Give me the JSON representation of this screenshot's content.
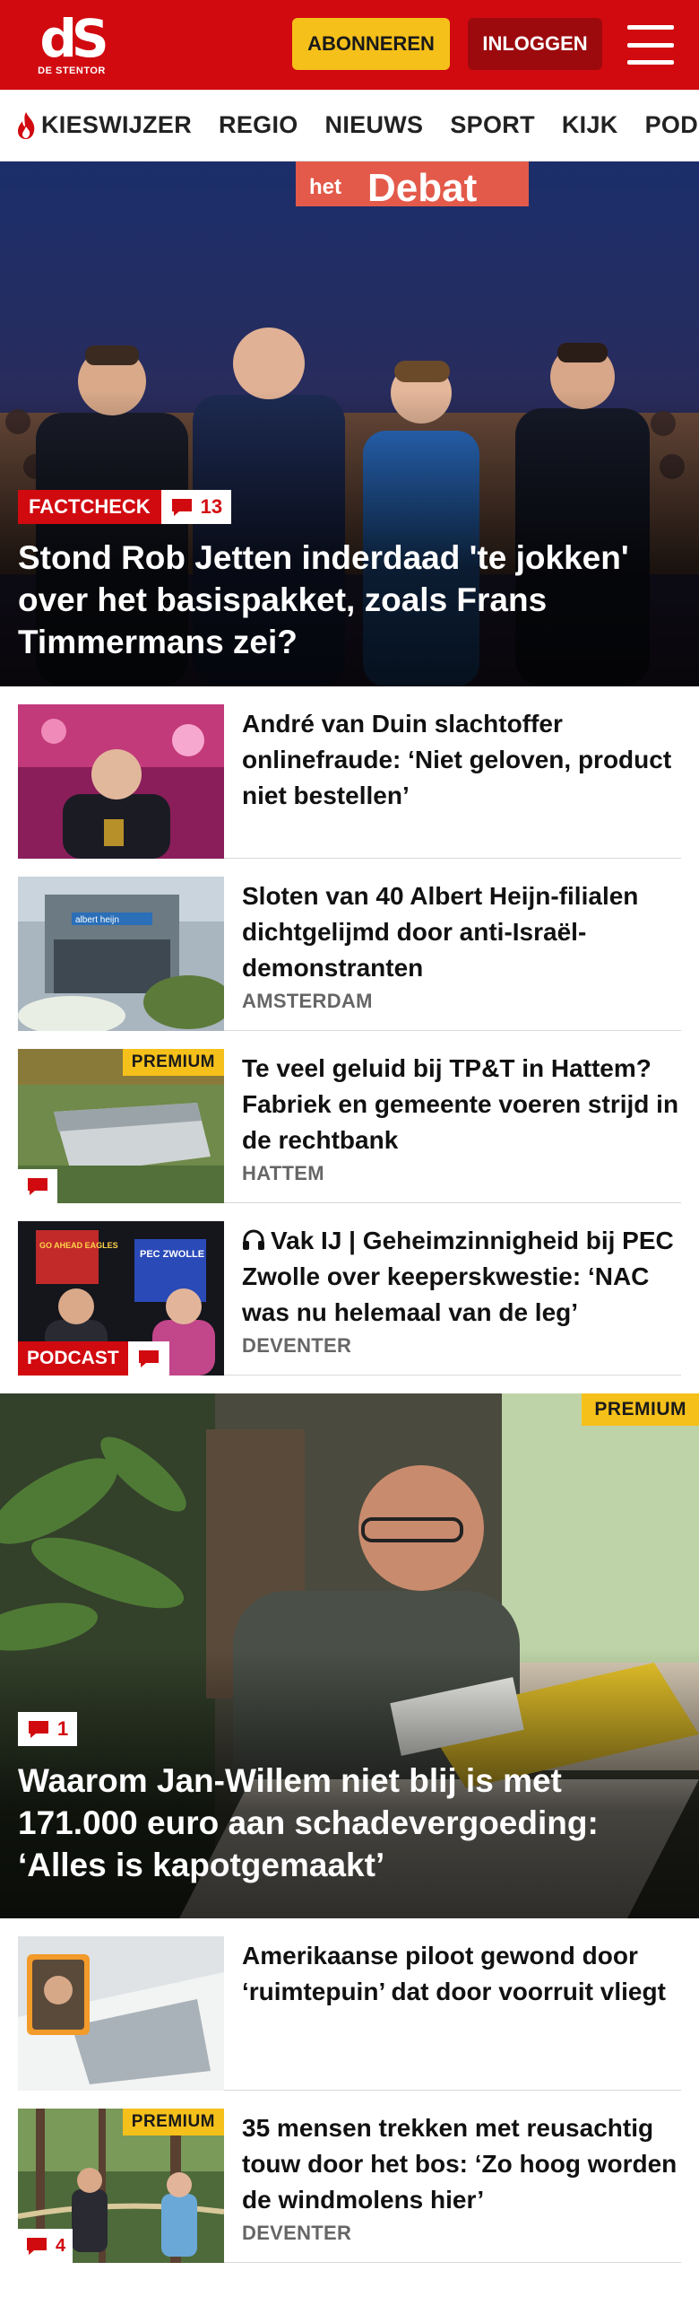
{
  "header": {
    "logo_text": "dS",
    "logo_sub": "DE STENTOR",
    "subscribe_label": "ABONNEREN",
    "login_label": "INLOGGEN"
  },
  "nav": {
    "items": [
      "KIESWIJZER",
      "REGIO",
      "NIEUWS",
      "SPORT",
      "KIJK",
      "PODCASTS"
    ]
  },
  "hero": {
    "banner_prefix": "het",
    "banner_text": "Debat",
    "tag": "FACTCHECK",
    "comments": "13",
    "title": "Stond Rob Jetten inderdaad 'te jokken' over het basispakket, zoals Frans Timmermans zei?"
  },
  "articles": [
    {
      "title": "André van Duin slachtoffer onlinefraude: ‘Niet geloven, product niet bestellen’",
      "location": ""
    },
    {
      "title": "Sloten van 40 Albert Heijn-filialen dichtgelijmd door anti-Israël-demonstranten",
      "location": "AMSTERDAM",
      "store_sign": "albert heijn"
    },
    {
      "title": "Te veel geluid bij TP&T in Hattem? Fabriek en gemeente voeren strijd in de rechtbank",
      "location": "HATTEM",
      "premium": "PREMIUM"
    },
    {
      "title": "Vak IJ | Geheimzinnigheid bij PEC Zwolle over keeperskwestie: ‘NAC was nu helemaal van de leg’",
      "location": "DEVENTER",
      "podcast": "PODCAST",
      "screen_left": "GO AHEAD EAGLES",
      "screen_right": "PEC ZWOLLE"
    }
  ],
  "feature": {
    "premium": "PREMIUM",
    "comments": "1",
    "title": "Waarom Jan-Willem niet blij is met 171.000 euro aan schadevergoeding: ‘Alles is kapotgemaakt’"
  },
  "articles2": [
    {
      "title": "Amerikaanse piloot gewond door ‘ruimtepuin’ dat door voorruit vliegt",
      "location": ""
    },
    {
      "title": "35 mensen trekken met reusachtig touw door het bos: ‘Zo hoog worden de windmolens hier’",
      "location": "DEVENTER",
      "premium": "PREMIUM",
      "comments": "4"
    }
  ],
  "colors": {
    "brand_red": "#d10a10",
    "premium_yellow": "#f5c01a",
    "login_dark_red": "#9c0a0e"
  },
  "icons": [
    "flame-icon",
    "comment-icon",
    "headphones-icon",
    "menu-icon"
  ]
}
